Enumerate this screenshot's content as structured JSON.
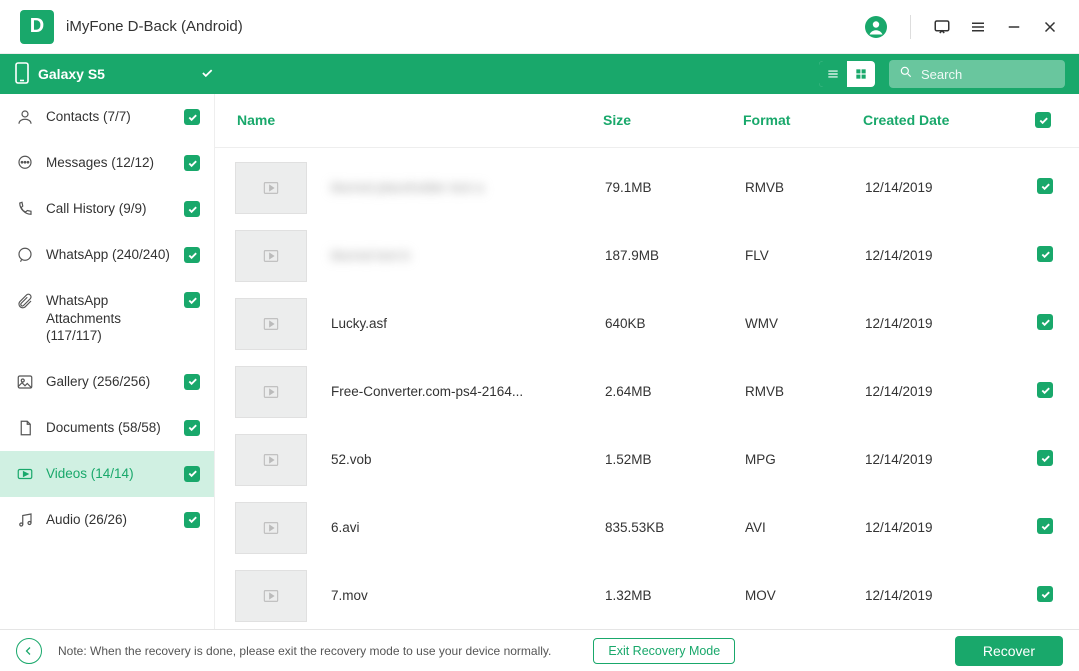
{
  "app": {
    "logo_letter": "D",
    "title": "iMyFone D-Back (Android)"
  },
  "device": {
    "name": "Galaxy S5"
  },
  "search": {
    "placeholder": "Search"
  },
  "sidebar": {
    "items": [
      {
        "label": "Contacts (7/7)",
        "icon": "contacts",
        "checked": true
      },
      {
        "label": "Messages (12/12)",
        "icon": "messages",
        "checked": true
      },
      {
        "label": "Call History (9/9)",
        "icon": "callhistory",
        "checked": true
      },
      {
        "label": "WhatsApp (240/240)",
        "icon": "whatsapp",
        "checked": true
      },
      {
        "label": "WhatsApp Attachments (117/117)",
        "icon": "attachments",
        "checked": true
      },
      {
        "label": "Gallery (256/256)",
        "icon": "gallery",
        "checked": true
      },
      {
        "label": "Documents (58/58)",
        "icon": "documents",
        "checked": true
      },
      {
        "label": "Videos (14/14)",
        "icon": "videos",
        "checked": true,
        "active": true
      },
      {
        "label": "Audio (26/26)",
        "icon": "audio",
        "checked": true
      }
    ]
  },
  "table": {
    "headers": {
      "name": "Name",
      "size": "Size",
      "format": "Format",
      "date": "Created Date"
    },
    "rows": [
      {
        "name": "blurred placeholder text a",
        "blurred": true,
        "size": "79.1MB",
        "format": "RMVB",
        "date": "12/14/2019",
        "checked": true
      },
      {
        "name": "blurred text b",
        "blurred": true,
        "size": "187.9MB",
        "format": "FLV",
        "date": "12/14/2019",
        "checked": true
      },
      {
        "name": "Lucky.asf",
        "size": "640KB",
        "format": "WMV",
        "date": "12/14/2019",
        "checked": true
      },
      {
        "name": "Free-Converter.com-ps4-2164...",
        "size": "2.64MB",
        "format": "RMVB",
        "date": "12/14/2019",
        "checked": true
      },
      {
        "name": "52.vob",
        "size": "1.52MB",
        "format": "MPG",
        "date": "12/14/2019",
        "checked": true
      },
      {
        "name": "6.avi",
        "size": "835.53KB",
        "format": "AVI",
        "date": "12/14/2019",
        "checked": true
      },
      {
        "name": "7.mov",
        "size": "1.32MB",
        "format": "MOV",
        "date": "12/14/2019",
        "checked": true
      }
    ]
  },
  "footer": {
    "note": "Note: When the recovery is done, please exit the recovery mode to use your device normally.",
    "exit_label": "Exit Recovery Mode",
    "recover_label": "Recover"
  },
  "colors": {
    "accent": "#19a86b"
  }
}
